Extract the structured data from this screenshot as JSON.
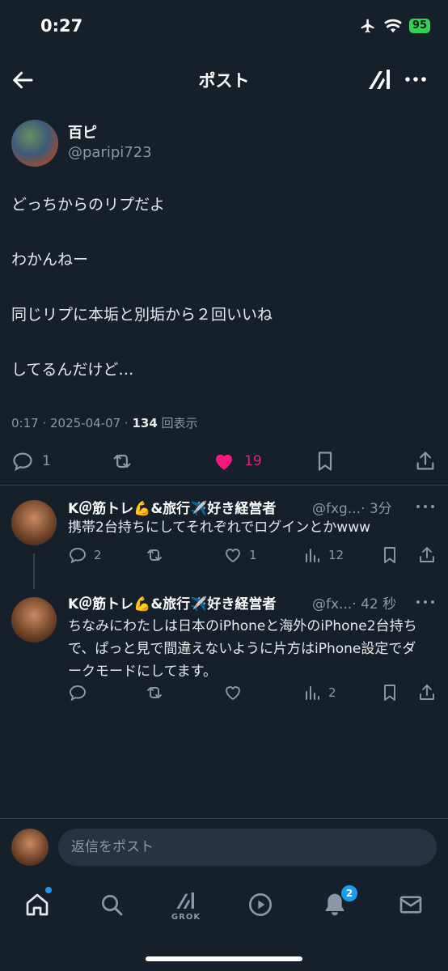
{
  "status_bar": {
    "time": "0:27",
    "battery": "95"
  },
  "header": {
    "title": "ポスト"
  },
  "post": {
    "author_name": "百ピ",
    "author_handle": "@paripi723",
    "text": "どっちからのリプだよ\n\nわかんねー\n\n同じリプに本垢と別垢から２回いいね\n\nしてるんだけど…",
    "meta_prefix": "0:17 · 2025-04-07 · ",
    "views_count": "134",
    "views_label": " 回表示",
    "reply_count": "1",
    "like_count": "19",
    "colors": {
      "like": "#f91880"
    }
  },
  "replies": [
    {
      "author_name": "K＠筋トレ💪&旅行✈️好き経営者",
      "handle": "@fxg...",
      "time": "· 3分",
      "text": "携帯2台持ちにしてそれぞれでログインとかwww",
      "reply_count": "2",
      "like_count": "1",
      "views_count": "12"
    },
    {
      "author_name": "K＠筋トレ💪&旅行✈️好き経営者",
      "handle": "@fx...",
      "time": "· 42 秒",
      "text": "ちなみにわたしは日本のiPhoneと海外のiPhone2台持ちで、ぱっと見で間違えないように片方はiPhone設定でダークモードにしてます。",
      "reply_count": "",
      "like_count": "",
      "views_count": "2"
    }
  ],
  "composer": {
    "placeholder": "返信をポスト"
  },
  "tab_bar": {
    "grok_label": "GROK",
    "notifications_badge": "2"
  }
}
